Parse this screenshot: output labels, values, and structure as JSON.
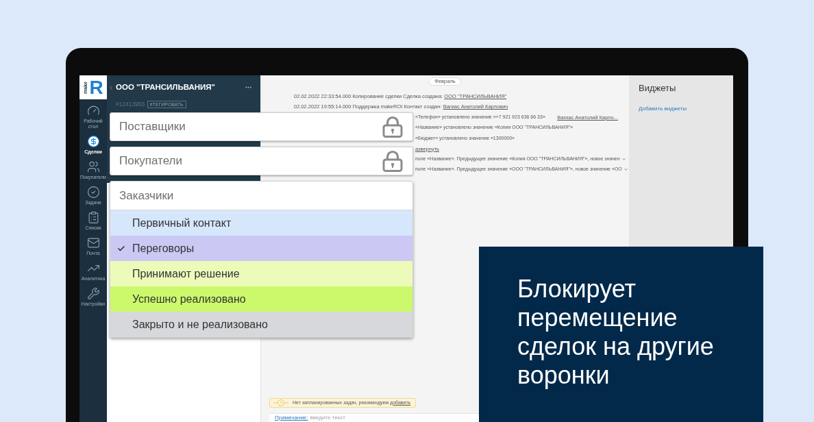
{
  "logo": {
    "word": "make",
    "letter": "R"
  },
  "nav": [
    {
      "label": "Рабочий стол",
      "selected": false
    },
    {
      "label": "Сделки",
      "selected": true
    },
    {
      "label": "Покупатели",
      "selected": false
    },
    {
      "label": "Задачи",
      "selected": false
    },
    {
      "label": "Списки",
      "selected": false
    },
    {
      "label": "Почта",
      "selected": false
    },
    {
      "label": "Аналитика",
      "selected": false
    },
    {
      "label": "Настройки",
      "selected": false
    }
  ],
  "deal": {
    "title": "ООО \"ТРАНСИЛЬВАНИЯ\"",
    "id": "#12413955",
    "tag": "#ТЕГИРОВАТЬ"
  },
  "feed": {
    "month": "Февраль",
    "entries": [
      {
        "kind": "event",
        "text": "02.02.2022 22:33:54.000 Копирование сделки Сделка создана:",
        "link": "ООО \"ТРАНСИЛЬВАНИЯ\""
      },
      {
        "kind": "event",
        "text": "02.02.2022 19:55:14.000 Поддержка makeROI Контакт создан:",
        "link": "Вагиас Анатолий Карлович"
      },
      {
        "kind": "change",
        "text": "«Телефон» установлено значение «+7 921 923 636 66 33»",
        "author": "Вагиас Анатолий Карло..."
      },
      {
        "kind": "change",
        "text": "«Название» установлено значение «Копия ООО \"ТРАНСИЛЬВАНИЯ\"»"
      },
      {
        "kind": "change",
        "text": "«Бюджет» установлено значение «1300000»"
      },
      {
        "kind": "toggle",
        "link": "азвернуть"
      },
      {
        "kind": "change",
        "text": "поле «Название». Предыдущее значение «Копия ООО \"ТРАНСИЛЬВАНИЯ\"», новое значен",
        "expandable": true
      },
      {
        "kind": "change",
        "text": "поле «Название». Предыдущее значение «ООО \"ТРАНСИЛЬВАНИЯ\"», новое значение «ОО",
        "expandable": true
      }
    ]
  },
  "widgets": {
    "title": "Виджеты",
    "add_link": "Добавить виджеты"
  },
  "tasks_notice": {
    "text": "Нет запланированных задач, рекомендуем",
    "link": "добавить"
  },
  "note": {
    "label": "Примечание:",
    "placeholder": "введите текст"
  },
  "pipelines": [
    {
      "name": "Поставщики",
      "locked": true
    },
    {
      "name": "Покупатели",
      "locked": true
    },
    {
      "name": "Заказчики",
      "locked": false,
      "stages": [
        {
          "name": "Первичный контакт",
          "color": "#d6e7fb",
          "selected": false
        },
        {
          "name": "Переговоры",
          "color": "#cbc9f4",
          "selected": true
        },
        {
          "name": "Принимают решение",
          "color": "#edfbba",
          "selected": false
        },
        {
          "name": "Успешно реализовано",
          "color": "#ccf96b",
          "selected": false
        },
        {
          "name": "Закрыто и не реализовано",
          "color": "#d6d8db",
          "selected": false
        }
      ]
    }
  ],
  "promo": {
    "text": "Блокирует перемещение сделок на другие воронки"
  }
}
